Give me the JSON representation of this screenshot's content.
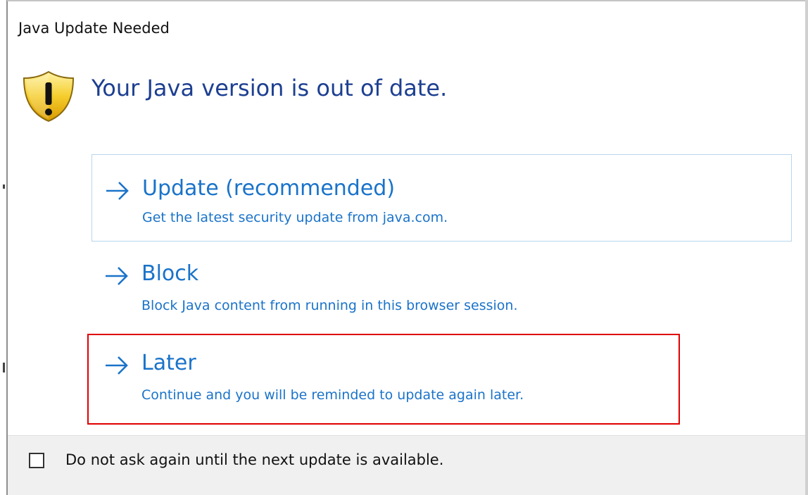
{
  "dialog": {
    "title": "Java Update Needed",
    "icon": "warning-shield-icon",
    "heading": "Your Java version is out of date."
  },
  "options": [
    {
      "title": "Update (recommended)",
      "description": "Get the latest security update from java.com.",
      "icon": "arrow-right-icon",
      "state": "hovered"
    },
    {
      "title": "Block",
      "description": "Block Java content from running in this browser session.",
      "icon": "arrow-right-icon",
      "state": "normal"
    },
    {
      "title": "Later",
      "description": "Continue and you will be reminded to update again later.",
      "icon": "arrow-right-icon",
      "state": "highlighted"
    }
  ],
  "footer": {
    "checkbox_label": "Do not ask again until the next update is available.",
    "checked": false
  },
  "colors": {
    "heading": "#1d3f91",
    "link": "#1a73c9",
    "hover_border": "#b8d6ee",
    "highlight_border": "#e00000",
    "footer_bg": "#f0f0f0"
  }
}
